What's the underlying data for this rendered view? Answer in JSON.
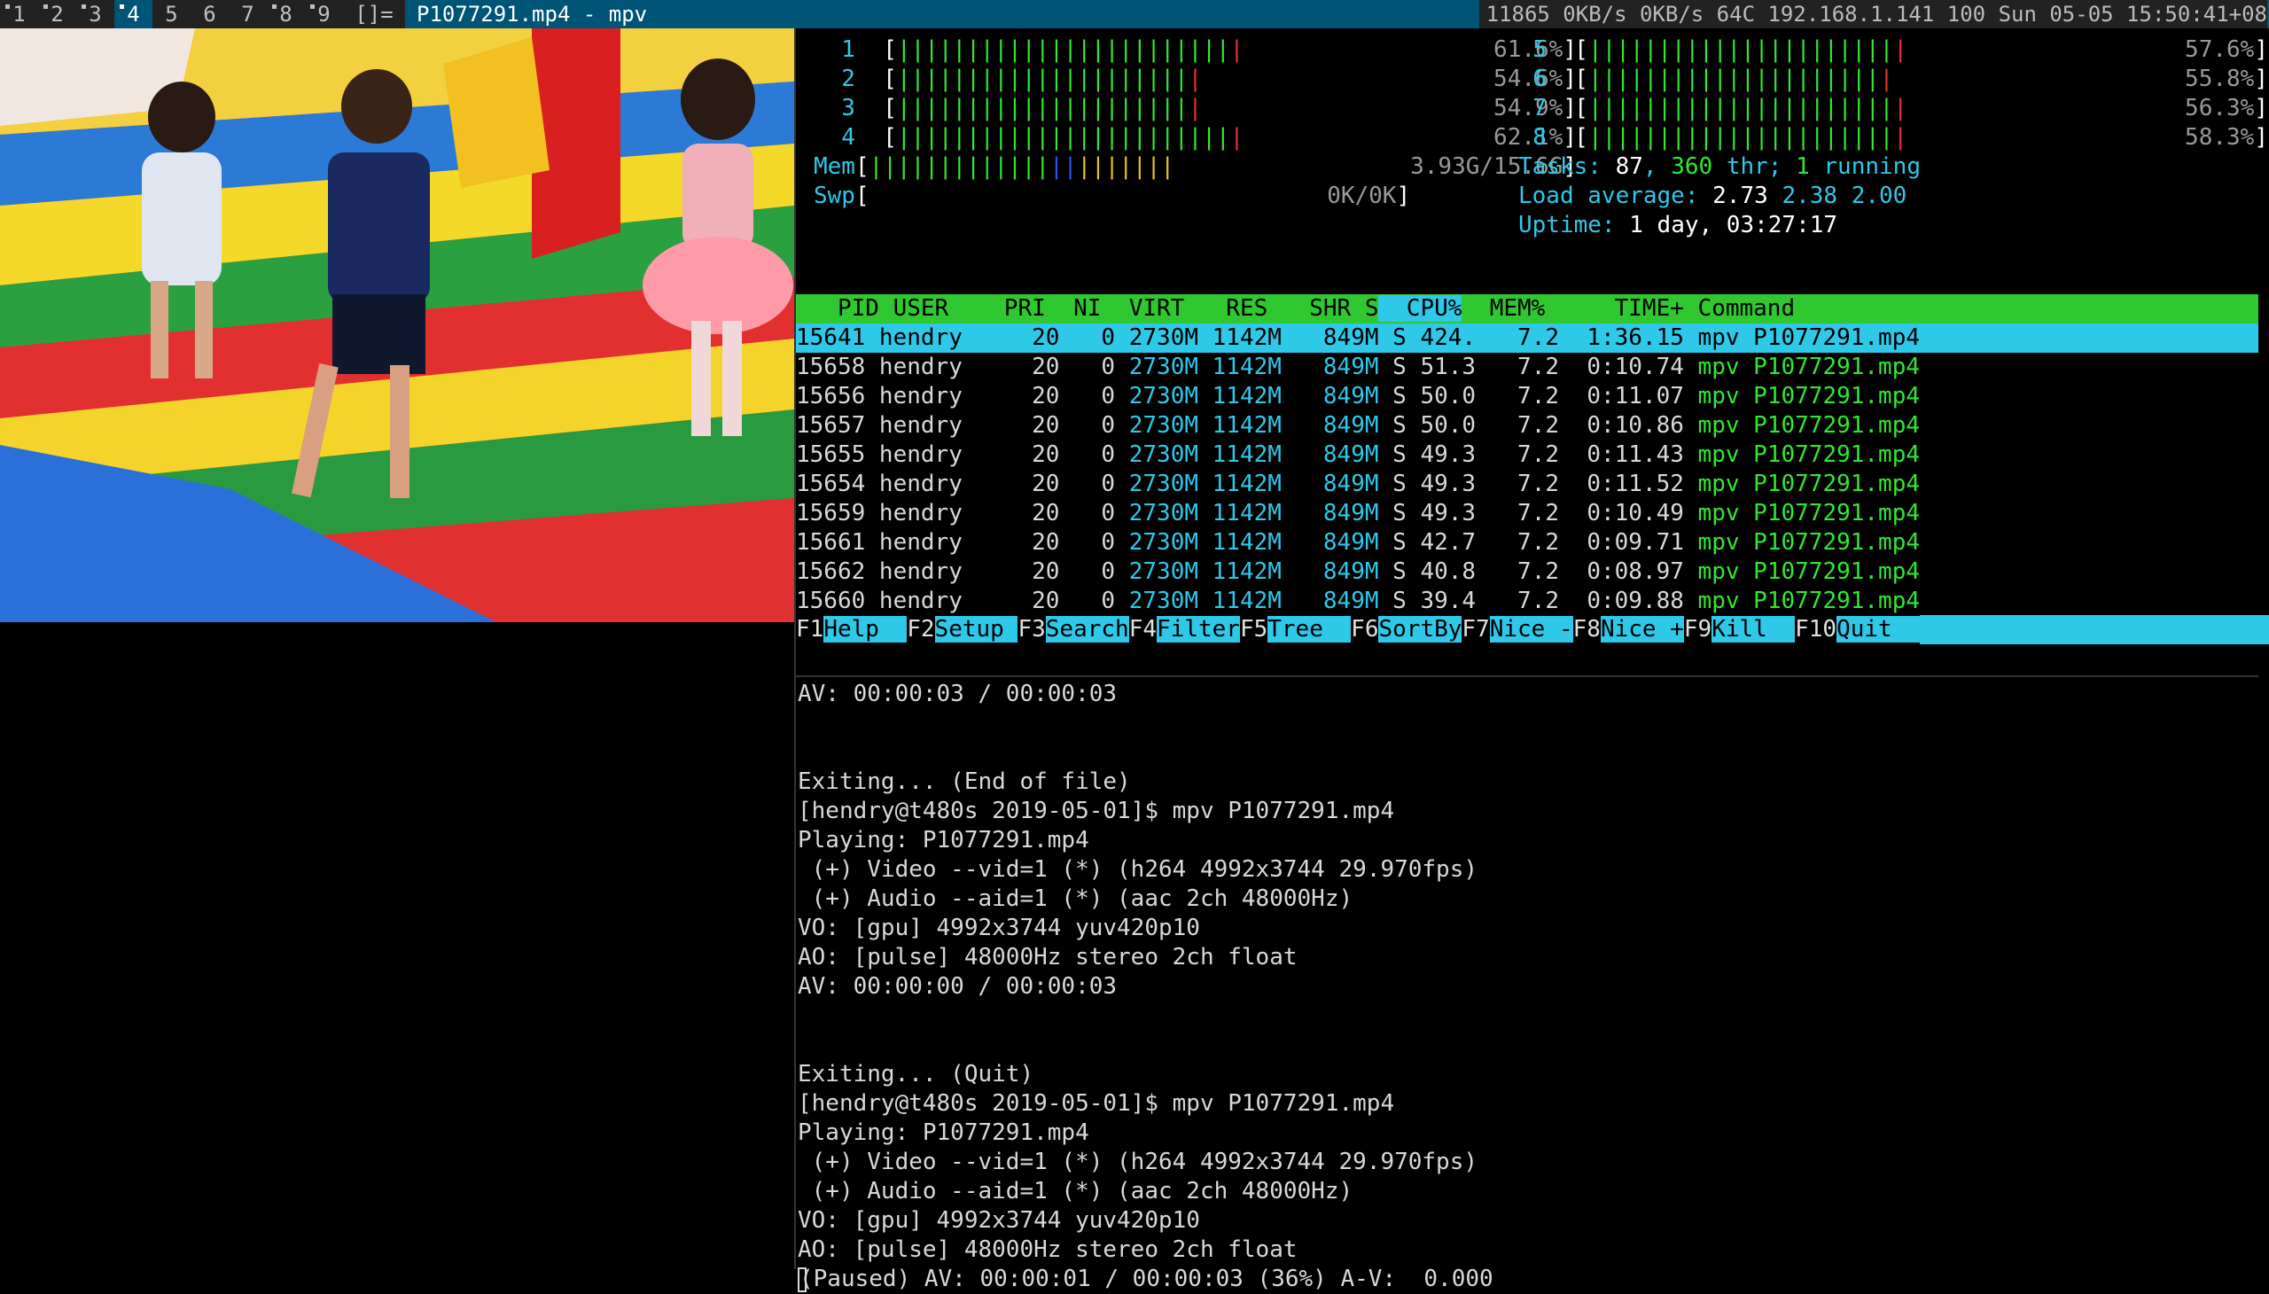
{
  "bar": {
    "tags": [
      {
        "label": "1",
        "occupied": true,
        "selected": false
      },
      {
        "label": "2",
        "occupied": true,
        "selected": false
      },
      {
        "label": "3",
        "occupied": true,
        "selected": false
      },
      {
        "label": "4",
        "occupied": true,
        "selected": true
      },
      {
        "label": "5",
        "occupied": false,
        "selected": false
      },
      {
        "label": "6",
        "occupied": false,
        "selected": false
      },
      {
        "label": "7",
        "occupied": false,
        "selected": false
      },
      {
        "label": "8",
        "occupied": true,
        "selected": false
      },
      {
        "label": "9",
        "occupied": true,
        "selected": false
      }
    ],
    "layout": "[]=",
    "title": "P1077291.mp4 - mpv",
    "status": "11865 0KB/s 0KB/s 64C  192.168.1.141 100 Sun 05-05 15:50:41+08"
  },
  "htop": {
    "cpus": [
      {
        "n": "1",
        "value": "61.6%"
      },
      {
        "n": "2",
        "value": "54.6%"
      },
      {
        "n": "3",
        "value": "54.9%"
      },
      {
        "n": "4",
        "value": "62.1%"
      },
      {
        "n": "5",
        "value": "57.6%"
      },
      {
        "n": "6",
        "value": "55.8%"
      },
      {
        "n": "7",
        "value": "56.3%"
      },
      {
        "n": "8",
        "value": "58.3%"
      }
    ],
    "mem_label": "Mem",
    "mem_value": "3.93G/15.6G",
    "swp_label": "Swp",
    "swp_value": "0K/0K",
    "tasks_label": "Tasks: ",
    "tasks": "87",
    "thr": "360",
    "thr_label": " thr; ",
    "running": "1",
    "running_label": " running",
    "load_label": "Load average: ",
    "load1": "2.73",
    "load5": "2.38",
    "load15": "2.00",
    "uptime_label": "Uptime: ",
    "uptime": "1 day, 03:27:17",
    "header": [
      "PID",
      "USER",
      "PRI",
      "NI",
      "VIRT",
      "RES",
      "SHR",
      "S",
      "CPU%",
      "MEM%",
      "TIME+",
      "Command"
    ],
    "processes": [
      {
        "pid": "15641",
        "user": "hendry",
        "pri": "20",
        "ni": "0",
        "virt": "2730M",
        "res": "1142M",
        "shr": "849M",
        "s": "S",
        "cpu": "424.",
        "mem": "7.2",
        "time": "1:36.15",
        "cmd": "mpv P1077291.mp4"
      },
      {
        "pid": "15658",
        "user": "hendry",
        "pri": "20",
        "ni": "0",
        "virt": "2730M",
        "res": "1142M",
        "shr": "849M",
        "s": "S",
        "cpu": "51.3",
        "mem": "7.2",
        "time": "0:10.74",
        "cmd": "mpv P1077291.mp4"
      },
      {
        "pid": "15656",
        "user": "hendry",
        "pri": "20",
        "ni": "0",
        "virt": "2730M",
        "res": "1142M",
        "shr": "849M",
        "s": "S",
        "cpu": "50.0",
        "mem": "7.2",
        "time": "0:11.07",
        "cmd": "mpv P1077291.mp4"
      },
      {
        "pid": "15657",
        "user": "hendry",
        "pri": "20",
        "ni": "0",
        "virt": "2730M",
        "res": "1142M",
        "shr": "849M",
        "s": "S",
        "cpu": "50.0",
        "mem": "7.2",
        "time": "0:10.86",
        "cmd": "mpv P1077291.mp4"
      },
      {
        "pid": "15655",
        "user": "hendry",
        "pri": "20",
        "ni": "0",
        "virt": "2730M",
        "res": "1142M",
        "shr": "849M",
        "s": "S",
        "cpu": "49.3",
        "mem": "7.2",
        "time": "0:11.43",
        "cmd": "mpv P1077291.mp4"
      },
      {
        "pid": "15654",
        "user": "hendry",
        "pri": "20",
        "ni": "0",
        "virt": "2730M",
        "res": "1142M",
        "shr": "849M",
        "s": "S",
        "cpu": "49.3",
        "mem": "7.2",
        "time": "0:11.52",
        "cmd": "mpv P1077291.mp4"
      },
      {
        "pid": "15659",
        "user": "hendry",
        "pri": "20",
        "ni": "0",
        "virt": "2730M",
        "res": "1142M",
        "shr": "849M",
        "s": "S",
        "cpu": "49.3",
        "mem": "7.2",
        "time": "0:10.49",
        "cmd": "mpv P1077291.mp4"
      },
      {
        "pid": "15661",
        "user": "hendry",
        "pri": "20",
        "ni": "0",
        "virt": "2730M",
        "res": "1142M",
        "shr": "849M",
        "s": "S",
        "cpu": "42.7",
        "mem": "7.2",
        "time": "0:09.71",
        "cmd": "mpv P1077291.mp4"
      },
      {
        "pid": "15662",
        "user": "hendry",
        "pri": "20",
        "ni": "0",
        "virt": "2730M",
        "res": "1142M",
        "shr": "849M",
        "s": "S",
        "cpu": "40.8",
        "mem": "7.2",
        "time": "0:08.97",
        "cmd": "mpv P1077291.mp4"
      },
      {
        "pid": "15660",
        "user": "hendry",
        "pri": "20",
        "ni": "0",
        "virt": "2730M",
        "res": "1142M",
        "shr": "849M",
        "s": "S",
        "cpu": "39.4",
        "mem": "7.2",
        "time": "0:09.88",
        "cmd": "mpv P1077291.mp4"
      }
    ],
    "fkeys": [
      {
        "key": "F1",
        "label": "Help  "
      },
      {
        "key": "F2",
        "label": "Setup "
      },
      {
        "key": "F3",
        "label": "Search"
      },
      {
        "key": "F4",
        "label": "Filter"
      },
      {
        "key": "F5",
        "label": "Tree  "
      },
      {
        "key": "F6",
        "label": "SortBy"
      },
      {
        "key": "F7",
        "label": "Nice -"
      },
      {
        "key": "F8",
        "label": "Nice +"
      },
      {
        "key": "F9",
        "label": "Kill  "
      },
      {
        "key": "F10",
        "label": "Quit  "
      }
    ]
  },
  "terminal": {
    "lines": [
      "AV: 00:00:03 / 00:00:03",
      "",
      "",
      "Exiting... (End of file)",
      "[hendry@t480s 2019-05-01]$ mpv P1077291.mp4",
      "Playing: P1077291.mp4",
      " (+) Video --vid=1 (*) (h264 4992x3744 29.970fps)",
      " (+) Audio --aid=1 (*) (aac 2ch 48000Hz)",
      "VO: [gpu] 4992x3744 yuv420p10",
      "AO: [pulse] 48000Hz stereo 2ch float",
      "AV: 00:00:00 / 00:00:03",
      "",
      "",
      "Exiting... (Quit)",
      "[hendry@t480s 2019-05-01]$ mpv P1077291.mp4",
      "Playing: P1077291.mp4",
      " (+) Video --vid=1 (*) (h264 4992x3744 29.970fps)",
      " (+) Audio --aid=1 (*) (aac 2ch 48000Hz)",
      "VO: [gpu] 4992x3744 yuv420p10",
      "AO: [pulse] 48000Hz stereo 2ch float",
      "(Paused) AV: 00:00:01 / 00:00:03 (36%) A-V:  0.000"
    ]
  }
}
